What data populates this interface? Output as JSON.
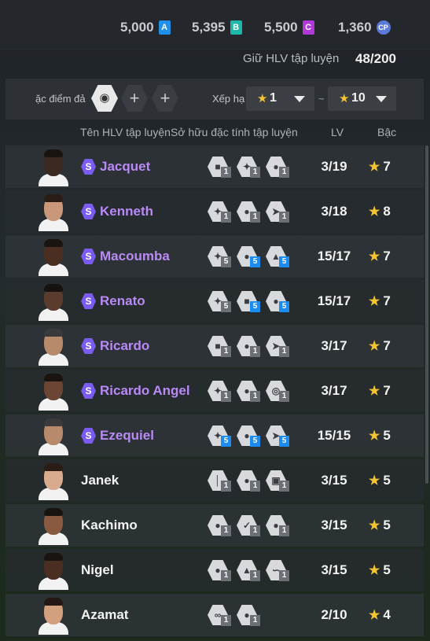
{
  "currencies": [
    {
      "value": "5,000",
      "letter": "A",
      "color": "#1f8fe8"
    },
    {
      "value": "5,395",
      "letter": "B",
      "color": "#1db8a8"
    },
    {
      "value": "5,500",
      "letter": "C",
      "color": "#b238d8"
    },
    {
      "value": "1,360",
      "letter": "CP",
      "color": "#5b79d6"
    }
  ],
  "hold": {
    "label": "Giữ HLV tập luyện",
    "count": "48/200"
  },
  "filter": {
    "traits_label": "ặc điểm đả",
    "rank_label": "Xếp hạ",
    "min_rank": "1",
    "max_rank": "10",
    "separator": "~",
    "add_symbol": "+"
  },
  "columns": {
    "name": "Tên HLV tập luyện",
    "traits": "Sở hữu đặc tính tập luyện",
    "lv": "LV",
    "rank": "Bậc"
  },
  "special_symbol": "S",
  "coaches": [
    {
      "name": "Jacquet",
      "special": true,
      "lv": "3/19",
      "rank": "7",
      "skin": "#3b2a22",
      "hair": "#1a1410",
      "traits": [
        {
          "icon": "lock-shield-icon",
          "level": "1",
          "blue": false
        },
        {
          "icon": "figure-icon",
          "level": "1",
          "blue": false
        },
        {
          "icon": "ball-icon",
          "level": "1",
          "blue": false
        }
      ]
    },
    {
      "name": "Kenneth",
      "special": true,
      "lv": "3/18",
      "rank": "8",
      "skin": "#c9977a",
      "hair": "#2a1d15",
      "traits": [
        {
          "icon": "figure-icon",
          "level": "1",
          "blue": false
        },
        {
          "icon": "ball-icon",
          "level": "1",
          "blue": false
        },
        {
          "icon": "running-icon",
          "level": "1",
          "blue": false
        }
      ]
    },
    {
      "name": "Macoumba",
      "special": true,
      "lv": "15/17",
      "rank": "7",
      "skin": "#4a2e22",
      "hair": "#1a1410",
      "traits": [
        {
          "icon": "figure-icon",
          "level": "5",
          "blue": false
        },
        {
          "icon": "ball-icon",
          "level": "5",
          "blue": true
        },
        {
          "icon": "shoe-icon",
          "level": "5",
          "blue": true
        }
      ]
    },
    {
      "name": "Renato",
      "special": true,
      "lv": "15/17",
      "rank": "7",
      "skin": "#5a3c2c",
      "hair": "#171210",
      "traits": [
        {
          "icon": "figure-icon",
          "level": "5",
          "blue": false
        },
        {
          "icon": "lock-shield-icon",
          "level": "5",
          "blue": true
        },
        {
          "icon": "ball-icon",
          "level": "5",
          "blue": true
        }
      ]
    },
    {
      "name": "Ricardo",
      "special": true,
      "lv": "3/17",
      "rank": "7",
      "skin": "#b88a6c",
      "hair": "#3a3a3a",
      "traits": [
        {
          "icon": "lock-shield-icon",
          "level": "1",
          "blue": false
        },
        {
          "icon": "ball-icon",
          "level": "1",
          "blue": false
        },
        {
          "icon": "running-icon",
          "level": "1",
          "blue": false
        }
      ]
    },
    {
      "name": "Ricardo Angel",
      "special": true,
      "lv": "3/17",
      "rank": "7",
      "skin": "#6b4634",
      "hair": "#1a1410",
      "traits": [
        {
          "icon": "figure-icon",
          "level": "1",
          "blue": false
        },
        {
          "icon": "ball-icon",
          "level": "1",
          "blue": false
        },
        {
          "icon": "target-icon",
          "level": "1",
          "blue": false
        }
      ]
    },
    {
      "name": "Ezequiel",
      "special": true,
      "lv": "15/15",
      "rank": "5",
      "skin": "#b88a6c",
      "hair": "#3a3a3a",
      "traits": [
        {
          "icon": "figure-icon",
          "level": "5",
          "blue": true
        },
        {
          "icon": "ball-icon",
          "level": "5",
          "blue": true
        },
        {
          "icon": "running-icon",
          "level": "5",
          "blue": true
        }
      ]
    },
    {
      "name": "Janek",
      "special": false,
      "lv": "3/15",
      "rank": "5",
      "skin": "#d9ab8e",
      "hair": "#2a1d15",
      "traits": [
        {
          "icon": "pole-icon",
          "level": "1",
          "blue": false
        },
        {
          "icon": "ball-icon",
          "level": "1",
          "blue": false
        },
        {
          "icon": "goal-icon",
          "level": "1",
          "blue": false
        }
      ]
    },
    {
      "name": "Kachimo",
      "special": false,
      "lv": "3/15",
      "rank": "5",
      "skin": "#8a5a40",
      "hair": "#1a1410",
      "traits": [
        {
          "icon": "ball-icon",
          "level": "1",
          "blue": false
        },
        {
          "icon": "kick-icon",
          "level": "1",
          "blue": false
        },
        {
          "icon": "ball-icon",
          "level": "1",
          "blue": false
        }
      ]
    },
    {
      "name": "Nigel",
      "special": false,
      "lv": "3/15",
      "rank": "5",
      "skin": "#4a2e22",
      "hair": "#1a1410",
      "traits": [
        {
          "icon": "ball-icon",
          "level": "1",
          "blue": false
        },
        {
          "icon": "shoe-icon",
          "level": "1",
          "blue": false
        },
        {
          "icon": "curve-icon",
          "level": "1",
          "blue": false
        }
      ]
    },
    {
      "name": "Azamat",
      "special": false,
      "lv": "2/10",
      "rank": "4",
      "skin": "#d2a07f",
      "hair": "#231812",
      "traits": [
        {
          "icon": "swirl-icon",
          "level": "1",
          "blue": false
        },
        {
          "icon": "ball-icon",
          "level": "1",
          "blue": false
        }
      ]
    }
  ]
}
